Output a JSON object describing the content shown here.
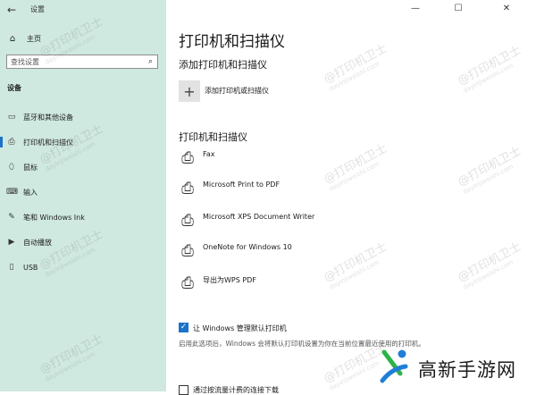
{
  "window": {
    "title": "设置",
    "minimize_glyph": "—",
    "maximize_glyph": "☐",
    "close_glyph": "✕"
  },
  "sidebar": {
    "back_glyph": "←",
    "home_label": "主页",
    "search_placeholder": "查找设置",
    "section_title": "设备",
    "items": [
      {
        "label": "蓝牙和其他设备",
        "icon": "bluetooth-icon"
      },
      {
        "label": "打印机和扫描仪",
        "icon": "printer-icon",
        "active": true
      },
      {
        "label": "鼠标",
        "icon": "mouse-icon"
      },
      {
        "label": "输入",
        "icon": "keyboard-icon"
      },
      {
        "label": "笔和 Windows Ink",
        "icon": "pen-icon"
      },
      {
        "label": "自动播放",
        "icon": "autoplay-icon"
      },
      {
        "label": "USB",
        "icon": "usb-icon"
      }
    ]
  },
  "main": {
    "page_title": "打印机和扫描仪",
    "add_section_title": "添加打印机和扫描仪",
    "add_button_label": "添加打印机或扫描仪",
    "list_section_title": "打印机和扫描仪",
    "printers": [
      {
        "name": "Fax",
        "icon": "fax-printer-icon"
      },
      {
        "name": "Microsoft Print to PDF",
        "icon": "pdf-printer-icon"
      },
      {
        "name": "Microsoft XPS Document Writer",
        "icon": "document-printer-icon"
      },
      {
        "name": "OneNote for Windows 10",
        "icon": "document-printer-icon"
      },
      {
        "name": "导出为WPS PDF",
        "icon": "printer-icon"
      }
    ],
    "default_printer_checkbox": {
      "label": "让 Windows 管理默认打印机",
      "checked": true
    },
    "default_printer_desc": "启用此选项后，Windows 会将默认打印机设置为你在当前位置最近使用的打印机。",
    "metered_checkbox": {
      "label": "通过按流量计费的连接下载",
      "checked": false
    }
  },
  "watermark": {
    "text": "@打印机卫士",
    "subtext": "dayinjiweishi.com"
  },
  "brand_logo": {
    "text": "高新手游网",
    "colors": {
      "green": "#2db34a",
      "blue": "#1f7fd6"
    }
  },
  "colors": {
    "sidebar_bg": "#cfe8e0",
    "accent": "#1a73c8"
  }
}
